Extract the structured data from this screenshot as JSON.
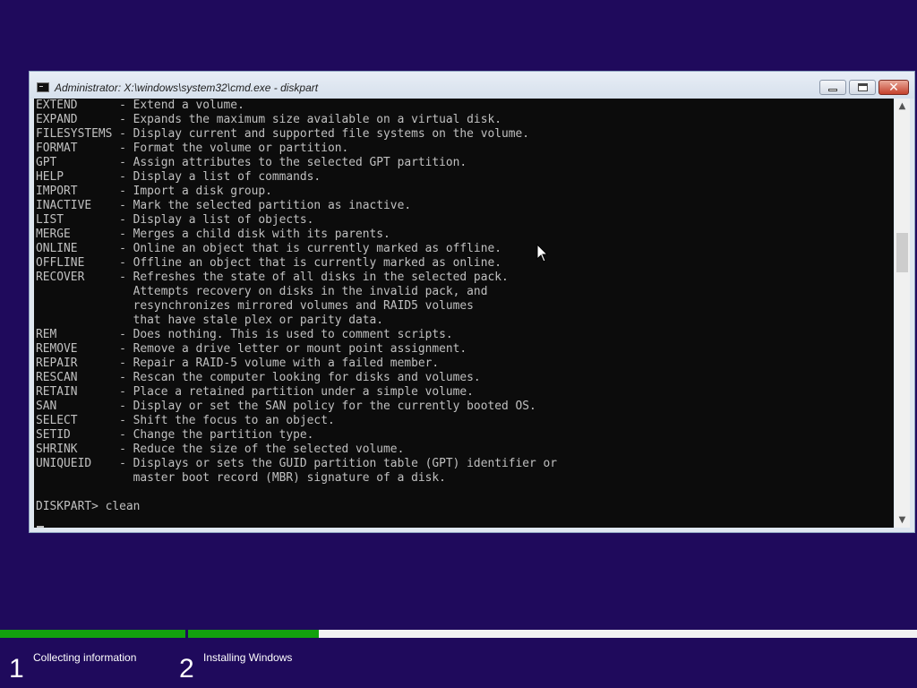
{
  "window": {
    "title": "Administrator: X:\\windows\\system32\\cmd.exe - diskpart",
    "icon": "console-icon",
    "controls": {
      "minimize": "minimize-icon",
      "maximize": "maximize-icon",
      "close": "close-icon"
    }
  },
  "console": {
    "lines": [
      "EXTEND      - Extend a volume.",
      "EXPAND      - Expands the maximum size available on a virtual disk.",
      "FILESYSTEMS - Display current and supported file systems on the volume.",
      "FORMAT      - Format the volume or partition.",
      "GPT         - Assign attributes to the selected GPT partition.",
      "HELP        - Display a list of commands.",
      "IMPORT      - Import a disk group.",
      "INACTIVE    - Mark the selected partition as inactive.",
      "LIST        - Display a list of objects.",
      "MERGE       - Merges a child disk with its parents.",
      "ONLINE      - Online an object that is currently marked as offline.",
      "OFFLINE     - Offline an object that is currently marked as online.",
      "RECOVER     - Refreshes the state of all disks in the selected pack.",
      "              Attempts recovery on disks in the invalid pack, and",
      "              resynchronizes mirrored volumes and RAID5 volumes",
      "              that have stale plex or parity data.",
      "REM         - Does nothing. This is used to comment scripts.",
      "REMOVE      - Remove a drive letter or mount point assignment.",
      "REPAIR      - Repair a RAID-5 volume with a failed member.",
      "RESCAN      - Rescan the computer looking for disks and volumes.",
      "RETAIN      - Place a retained partition under a simple volume.",
      "SAN         - Display or set the SAN policy for the currently booted OS.",
      "SELECT      - Shift the focus to an object.",
      "SETID       - Change the partition type.",
      "SHRINK      - Reduce the size of the selected volume.",
      "UNIQUEID    - Displays or sets the GUID partition table (GPT) identifier or",
      "              master boot record (MBR) signature of a disk.",
      "",
      "DISKPART> clean"
    ],
    "background": "#0c0c0c",
    "foreground": "#c0c0c0"
  },
  "setup": {
    "background": "#1f0a5c",
    "progress_color": "#13a10e",
    "steps": [
      {
        "number": "1",
        "label": "Collecting information",
        "progress": 1.0
      },
      {
        "number": "2",
        "label": "Installing Windows",
        "progress": 0.22
      }
    ]
  }
}
